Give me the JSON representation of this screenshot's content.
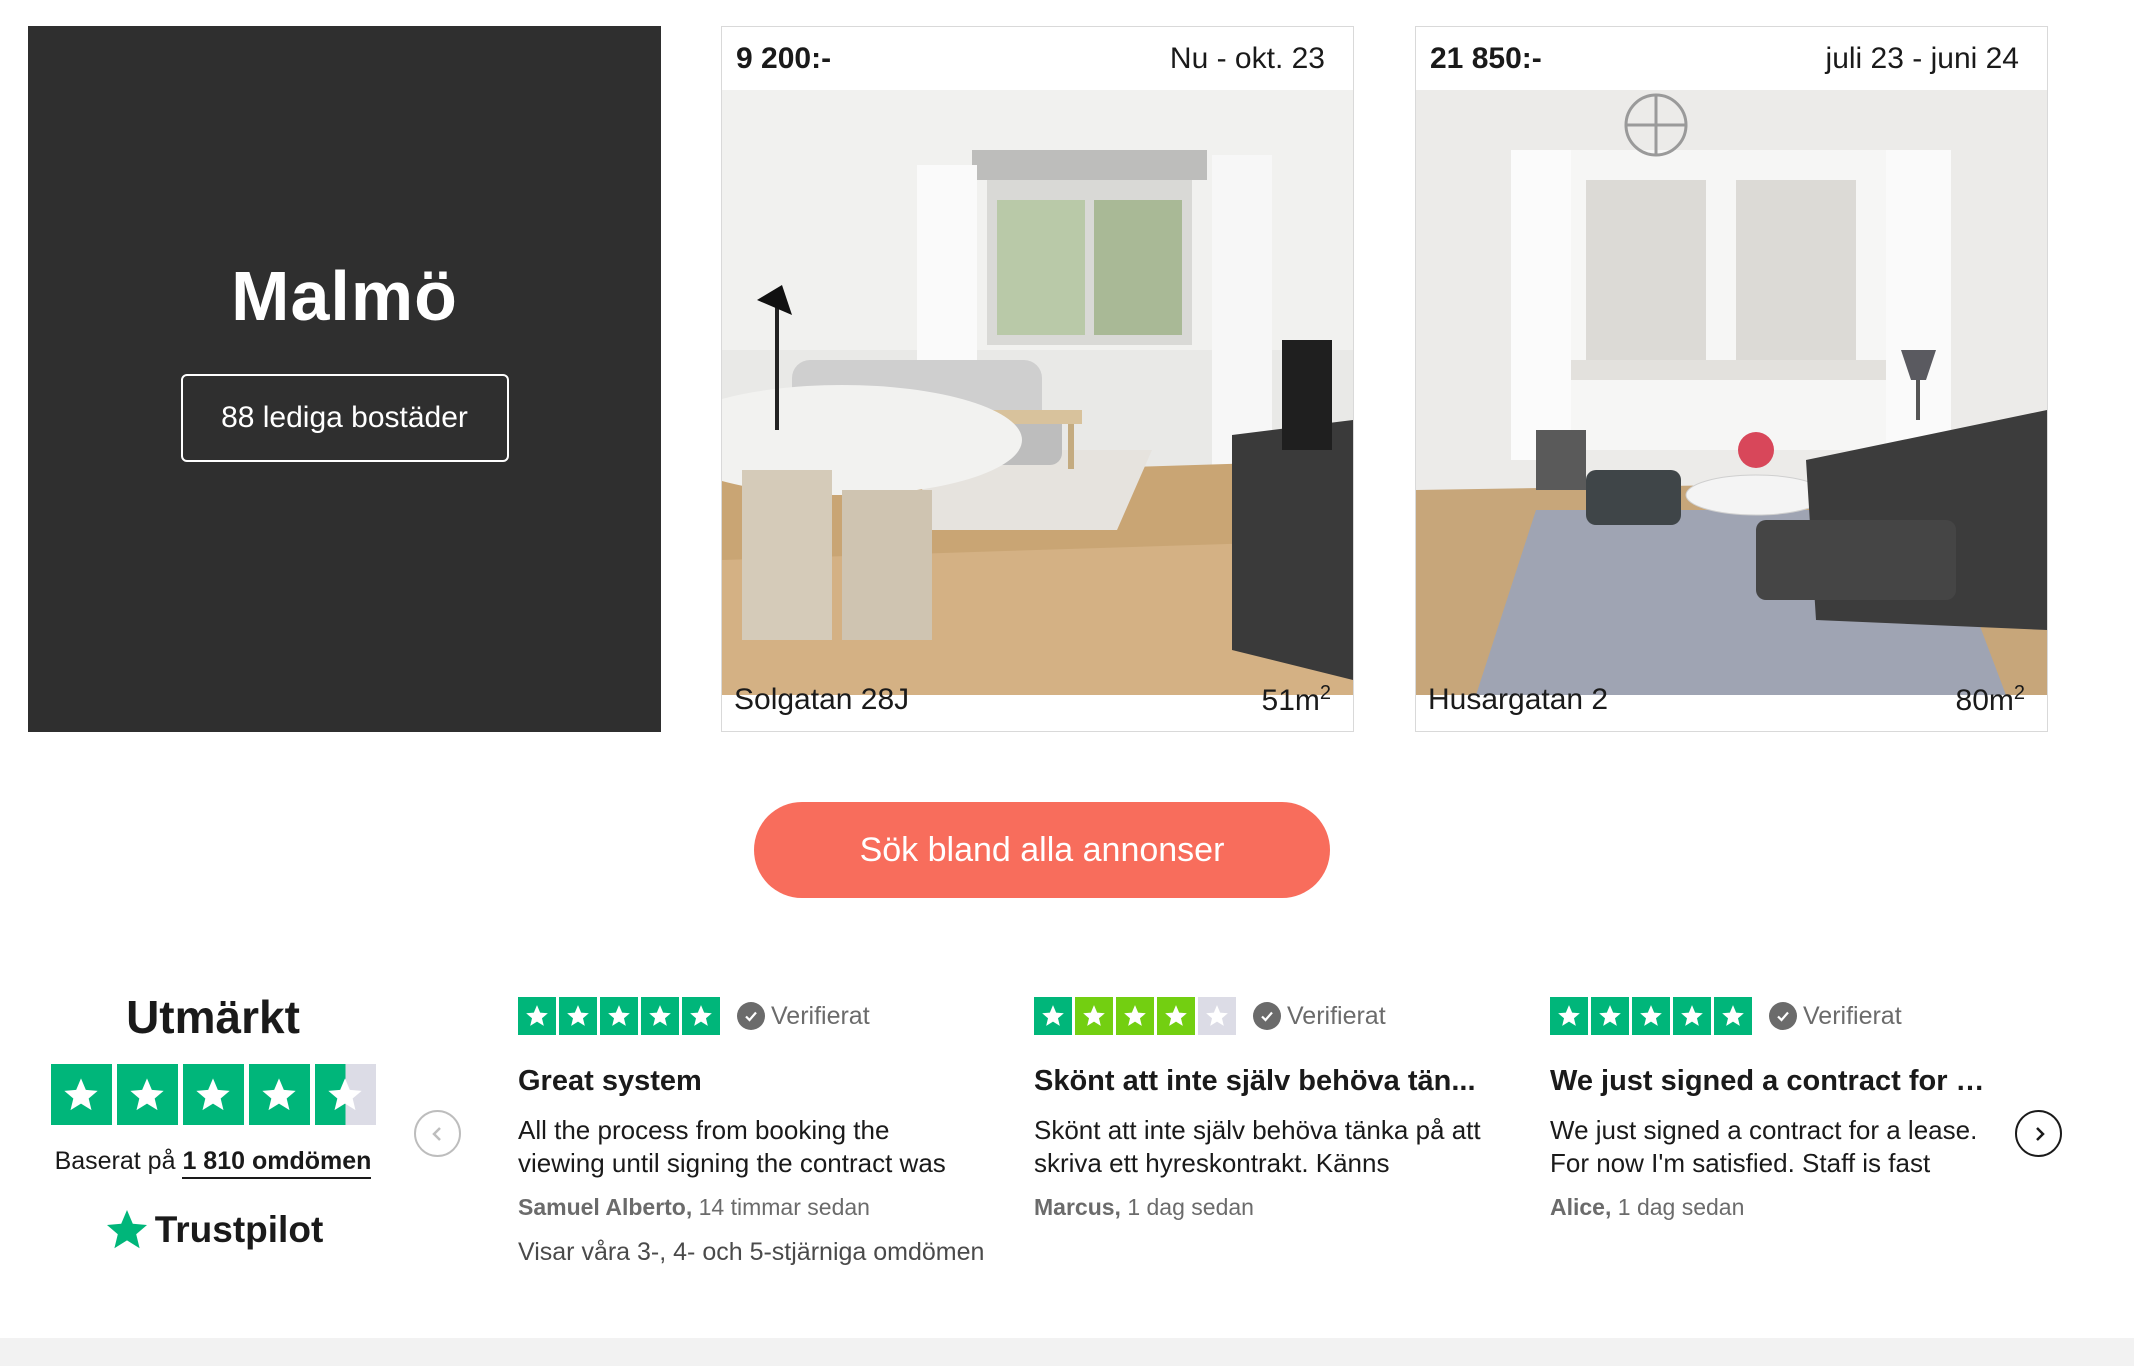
{
  "city": {
    "name": "Malmö",
    "count_label": "88 lediga bostäder"
  },
  "listings": [
    {
      "price": "9 200:-",
      "dates": "Nu - okt. 23",
      "address": "Solgatan 28J",
      "size": "51m",
      "size_sup": "2"
    },
    {
      "price": "21 850:-",
      "dates": "juli 23 - juni 24",
      "address": "Husargatan 2",
      "size": "80m",
      "size_sup": "2"
    }
  ],
  "cta": {
    "label": "Sök bland alla annonser"
  },
  "trustpilot": {
    "rating_word": "Utmärkt",
    "rating_stars": 4.5,
    "based_prefix": "Baserat på",
    "review_count": "1 810 omdömen",
    "brand": "Trustpilot",
    "brand_color": "#00b67a",
    "footnote": "Visar våra 3-, 4- och 5-stjärniga omdömen",
    "reviews": [
      {
        "stars": 5,
        "verified": "Verifierat",
        "title": "Great system",
        "body": "All the process from booking the viewing until signing the contract was",
        "author": "Samuel Alberto,",
        "time": "14 timmar sedan"
      },
      {
        "stars": 4,
        "verified": "Verifierat",
        "title": "Skönt att inte själv behöva tän...",
        "body": "Skönt att inte själv behöva tänka på att skriva ett hyreskontrakt. Känns",
        "author": "Marcus,",
        "time": "1 dag sedan"
      },
      {
        "stars": 5,
        "verified": "Verifierat",
        "title": "We just signed a contract for a ...",
        "body": "We just signed a contract for a lease. For now I'm satisfied. Staff is fast",
        "author": "Alice,",
        "time": "1 dag sedan"
      }
    ]
  },
  "colors": {
    "cta": "#f86d5c",
    "city_card": "#2f2f2f",
    "star_green": "#00b67a"
  }
}
